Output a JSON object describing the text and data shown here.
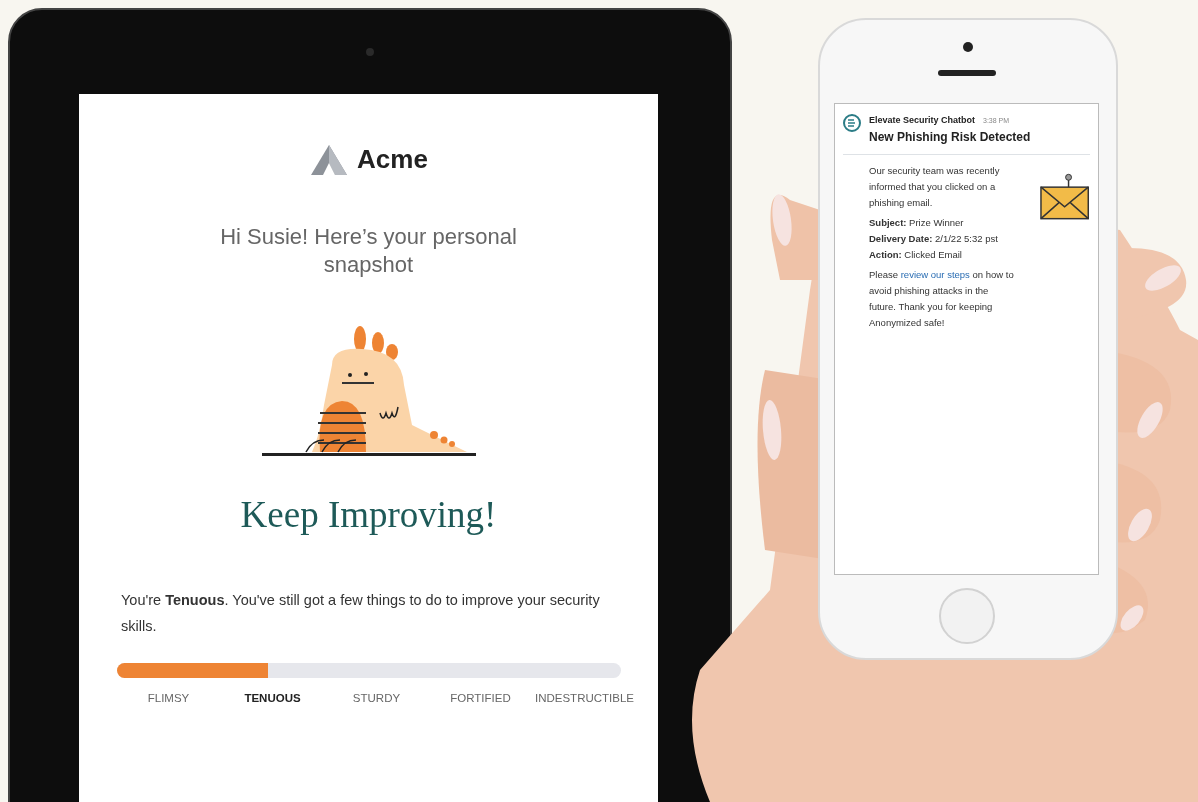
{
  "tablet": {
    "email": {
      "brand": "Acme",
      "greeting": "Hi Susie! Here’s your personal snapshot",
      "headline": "Keep Improving!",
      "message": "You're **Tenuous**. You've still got a few things to do to improve your security skills.",
      "meter": {
        "level": 0.3,
        "levels": [
          {
            "label": "FLIMSY",
            "selected": false
          },
          {
            "label": "TENUOUS",
            "selected": true
          },
          {
            "label": "STURDY",
            "selected": false
          },
          {
            "label": "FORTIFIED",
            "selected": false
          },
          {
            "label": "INDESTRUCTIBLE",
            "selected": false
          }
        ]
      }
    }
  },
  "phone": {
    "message": {
      "sender": "Elevate Security Chatbot",
      "time": "3:38 PM",
      "title": "New Phishing Risk Detected",
      "intro": "Our security team was recently informed that you clicked on a phishing email.",
      "details": [
        "**Subject:** Prize Winner",
        "**Delivery Date:** 2/1/22 5:32 pst",
        "**Action:** Clicked Email"
      ],
      "closing": {
        "before": "Please",
        "link": "review our steps",
        "after": "on how to avoid phishing attacks in the future. Thank you for keeping Anonymized safe!"
      }
    }
  }
}
